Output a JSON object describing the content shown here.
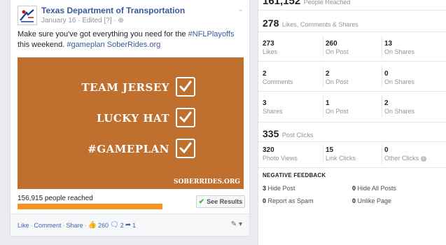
{
  "post": {
    "page_name": "Texas Department of Transportation",
    "meta": "January 16 · Edited [?] · ",
    "text_before": "Make sure you've got everything you need for the ",
    "hashtag1": "#NFLPlayoffs",
    "text_mid": " this weekend. ",
    "hashtag2": "#gameplan",
    "text_after": " ",
    "link": "SoberRides.org",
    "image": {
      "bg_color": "#bf6f2e",
      "lines": [
        "TEAM JERSEY",
        "LUCKY HAT",
        "#GAMEPLAN"
      ],
      "url": "SOBERRIDES.ORG"
    },
    "reach_text": "156,915 people reached",
    "reach_bar_color": "#f7931e",
    "see_results": "See Results",
    "actions": {
      "like": "Like",
      "comment": "Comment",
      "share": "Share",
      "likes_count": "260",
      "comments_count": "2",
      "shares_count": "1"
    }
  },
  "stats": {
    "people_reached_value": "161,152",
    "people_reached_label": "People Reached",
    "lcs_total": "278",
    "lcs_label": "Likes, Comments & Shares",
    "lcs_rows": [
      [
        {
          "v": "273",
          "l": "Likes"
        },
        {
          "v": "260",
          "l": "On Post"
        },
        {
          "v": "13",
          "l": "On Shares"
        }
      ],
      [
        {
          "v": "2",
          "l": "Comments"
        },
        {
          "v": "2",
          "l": "On Post"
        },
        {
          "v": "0",
          "l": "On Shares"
        }
      ],
      [
        {
          "v": "3",
          "l": "Shares"
        },
        {
          "v": "1",
          "l": "On Post"
        },
        {
          "v": "2",
          "l": "On Shares"
        }
      ]
    ],
    "post_clicks_total": "335",
    "post_clicks_label": "Post Clicks",
    "clicks": [
      {
        "v": "320",
        "l": "Photo Views"
      },
      {
        "v": "15",
        "l": "Link Clicks"
      },
      {
        "v": "0",
        "l": "Other Clicks"
      }
    ],
    "negative_title": "NEGATIVE FEEDBACK",
    "negative": [
      {
        "v": "3",
        "l": "Hide Post"
      },
      {
        "v": "0",
        "l": "Hide All Posts"
      },
      {
        "v": "0",
        "l": "Report as Spam"
      },
      {
        "v": "0",
        "l": "Unlike Page"
      }
    ]
  }
}
